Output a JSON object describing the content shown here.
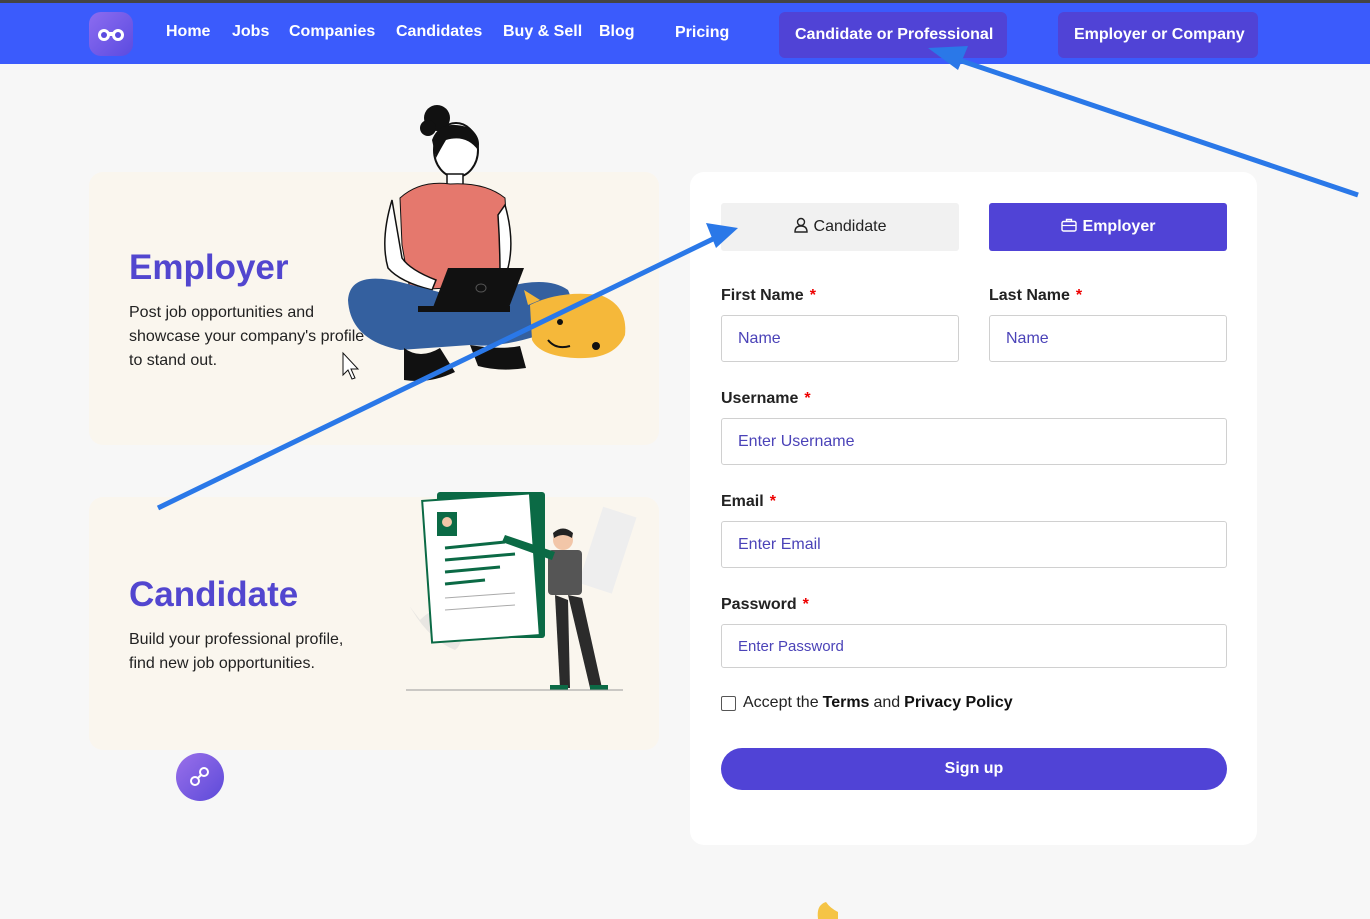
{
  "nav": {
    "links": [
      "Home",
      "Jobs",
      "Companies",
      "Candidates",
      "Buy & Sell",
      "Blog",
      "Pricing"
    ],
    "candidate_button": "Candidate or Professional",
    "employer_button": "Employer or Company",
    "logo_icon": "binoculars-icon"
  },
  "cards": {
    "employer": {
      "title": "Employer",
      "desc_lines": [
        "Post job opportunities and",
        "showcase your company's profile",
        "to stand out."
      ]
    },
    "candidate": {
      "title": "Candidate",
      "desc_lines": [
        "Build your professional profile,",
        "find new job opportunities."
      ]
    }
  },
  "form": {
    "tabs": {
      "candidate": "Candidate",
      "employer": "Employer",
      "selected": "Employer"
    },
    "first_name": {
      "label": "First Name",
      "placeholder": "Name"
    },
    "last_name": {
      "label": "Last Name",
      "placeholder": "Name"
    },
    "username": {
      "label": "Username",
      "placeholder": "Enter Username"
    },
    "email": {
      "label": "Email",
      "placeholder": "Enter Email"
    },
    "password": {
      "label": "Password",
      "placeholder": "Enter Password"
    },
    "required_mark": "*",
    "terms": {
      "prefix": "Accept the",
      "terms": "Terms",
      "and": "and",
      "privacy": "Privacy Policy"
    },
    "submit": "Sign up"
  },
  "colors": {
    "nav_bg": "#3b5bfc",
    "accent": "#5043d6",
    "card_bg": "#faf6ee",
    "annotation_arrow": "#2a78e8"
  }
}
